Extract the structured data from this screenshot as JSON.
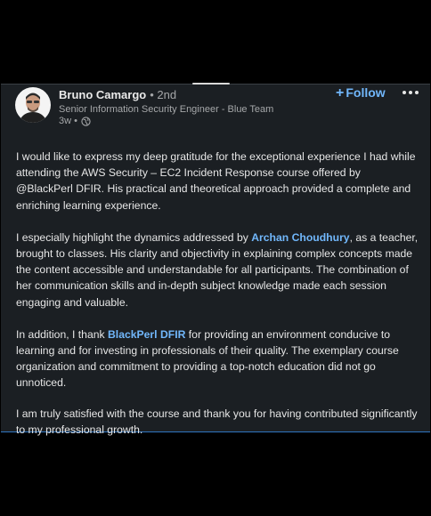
{
  "post": {
    "author": {
      "name": "Bruno Camargo",
      "degree": "• 2nd",
      "headline": "Senior Information Security Engineer - Blue Team",
      "time": "3w •"
    },
    "follow_label": "Follow",
    "follow_plus": "+",
    "more_icon": "more-horizontal-icon",
    "visibility_icon": "globe-icon",
    "body": {
      "p1": "I would like to express my deep gratitude for the exceptional experience I had while attending the AWS Security – EC2 Incident Response course offered by @BlackPerl DFIR. His practical and theoretical approach provided a complete and enriching learning experience.",
      "p2_before": "I especially highlight the dynamics addressed by ",
      "p2_mention": "Archan Choudhury",
      "p2_after": ", as a teacher, brought to classes. His clarity and objectivity in explaining complex concepts made the content accessible and understandable for all participants. The combination of her communication skills and in-depth subject knowledge made each session engaging and valuable.",
      "p3_before": "In addition, I thank ",
      "p3_mention": "BlackPerl DFIR",
      "p3_after": " for providing an environment conducive to learning and for investing in professionals of their quality. The exemplary course organization and commitment to providing a top-notch education did not go unnoticed.",
      "p4": "I am truly satisfied with the course and thank you for having contributed significantly to my professional growth."
    }
  },
  "colors": {
    "background": "#000000",
    "card": "#1b1f23",
    "accent": "#71b7fb",
    "text": "#e6e6e6",
    "muted": "#a5a7a9"
  }
}
